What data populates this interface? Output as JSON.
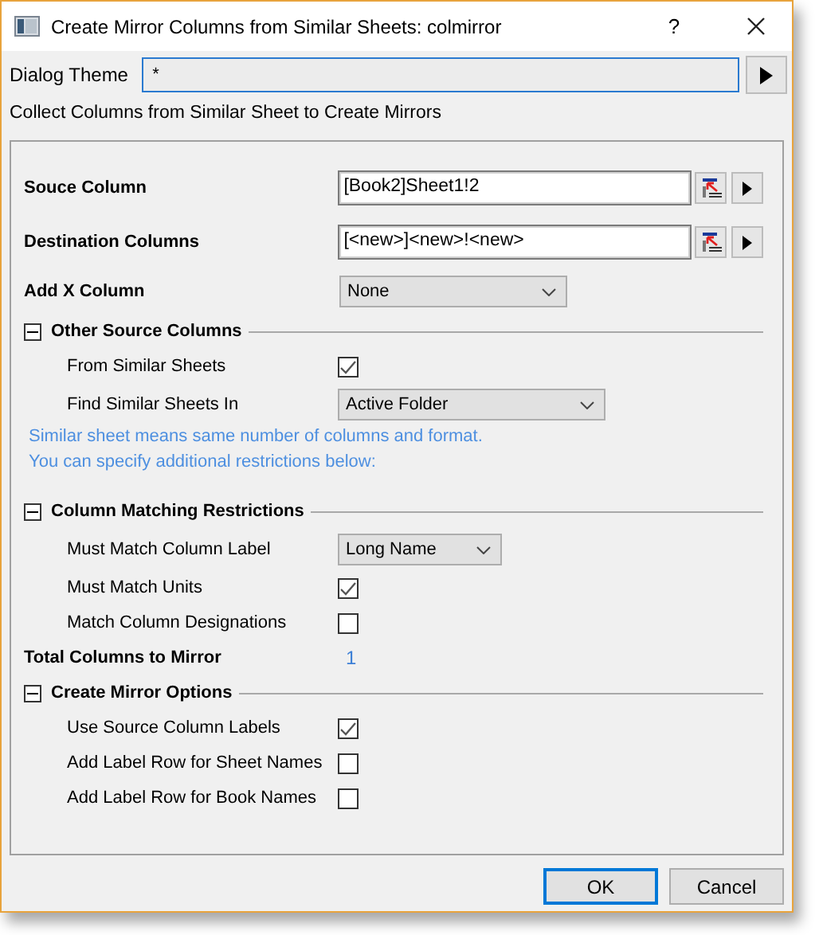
{
  "window": {
    "title": "Create Mirror Columns from Similar Sheets: colmirror",
    "help": "?"
  },
  "dialog_theme": {
    "label": "Dialog Theme",
    "value": "*"
  },
  "description": "Collect Columns from Similar Sheet to Create Mirrors",
  "items": [
    {
      "kind": "field",
      "label": "Souce Column",
      "value": "[Book2]Sheet1!2"
    },
    {
      "kind": "field",
      "label": "Destination Columns",
      "value": "[<new>]<new>!<new>"
    },
    {
      "kind": "dropdown",
      "label": "Add X Column",
      "value": "None"
    },
    {
      "kind": "section",
      "title": "Other Source Columns",
      "expanded": true,
      "children": [
        {
          "kind": "checkbox",
          "label": "From Similar Sheets",
          "checked": true
        },
        {
          "kind": "dropdown",
          "label": "Find Similar Sheets In",
          "value": "Active Folder"
        },
        {
          "kind": "note",
          "lines": [
            "Similar sheet means same number of columns and format.",
            "You can specify additional restrictions below:"
          ]
        }
      ]
    },
    {
      "kind": "section",
      "title": "Column Matching Restrictions",
      "expanded": true,
      "children": [
        {
          "kind": "dropdown",
          "label": "Must Match Column Label",
          "value": "Long Name"
        },
        {
          "kind": "checkbox",
          "label": "Must Match Units",
          "checked": true
        },
        {
          "kind": "checkbox",
          "label": "Match Column Designations",
          "checked": false
        }
      ]
    },
    {
      "kind": "value",
      "label": "Total Columns to Mirror",
      "value": "1"
    },
    {
      "kind": "section",
      "title": "Create Mirror Options",
      "expanded": true,
      "children": [
        {
          "kind": "checkbox",
          "label": "Use Source Column Labels",
          "checked": true
        },
        {
          "kind": "checkbox",
          "label": "Add Label Row for Sheet Names",
          "checked": false
        },
        {
          "kind": "checkbox",
          "label": "Add Label Row for Book Names",
          "checked": false
        }
      ]
    }
  ],
  "buttons": [
    {
      "label": "OK",
      "default": true
    },
    {
      "label": "Cancel",
      "default": false
    }
  ]
}
